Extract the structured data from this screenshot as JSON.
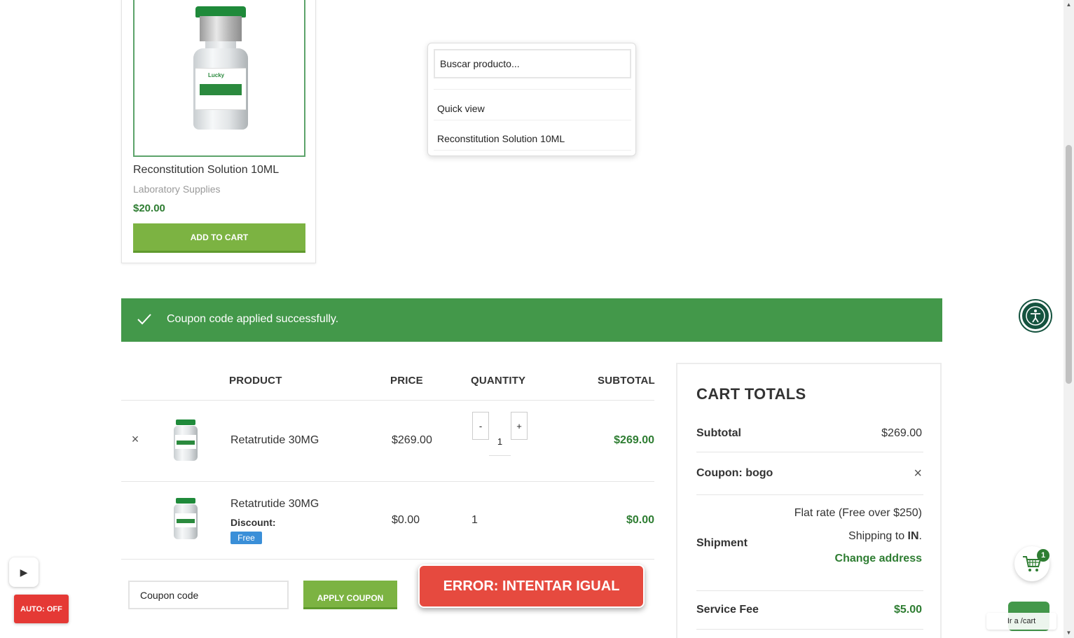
{
  "product_card": {
    "name": "Reconstitution Solution 10ML",
    "category": "Laboratory Supplies",
    "price": "$20.00",
    "add_to_cart_label": "ADD TO CART",
    "image_logo": "Lucky"
  },
  "popup": {
    "search_value": "Buscar producto...",
    "items": [
      "Quick view",
      "Reconstitution Solution 10ML"
    ]
  },
  "banner": {
    "message": "Coupon code applied successfully."
  },
  "cart_table": {
    "headers": {
      "product": "PRODUCT",
      "price": "PRICE",
      "quantity": "QUANTITY",
      "subtotal": "SUBTOTAL"
    },
    "rows": [
      {
        "name": "Retatrutide 30MG",
        "price": "$269.00",
        "quantity": "1",
        "subtotal": "$269.00"
      },
      {
        "name": "Retatrutide 30MG",
        "price": "$0.00",
        "quantity": "1",
        "subtotal": "$0.00",
        "discount_label": "Discount:",
        "badge": "Free"
      }
    ],
    "qty_minus": "-",
    "qty_plus": "+",
    "remove_glyph": "×"
  },
  "coupon": {
    "placeholder": "Coupon code",
    "apply_label": "APPLY COUPON"
  },
  "error_button": "ERROR: INTENTAR IGUAL",
  "cart_totals": {
    "title": "CART TOTALS",
    "subtotal_label": "Subtotal",
    "subtotal_value": "$269.00",
    "coupon_label": "Coupon: bogo",
    "coupon_remove": "×",
    "shipment_label": "Shipment",
    "shipping_method": "Flat rate (Free over $250)",
    "shipping_to_prefix": "Shipping to ",
    "shipping_to_country": "IN",
    "shipping_to_suffix": ".",
    "change_address": "Change address",
    "service_fee_label": "Service Fee",
    "service_fee_value": "$5.00"
  },
  "widgets": {
    "play_glyph": "▶",
    "auto_label": "AUTO: OFF",
    "cart_count": "1",
    "goto_label": "Ir a /cart"
  },
  "icons": {
    "accessibility": "accessibility-icon",
    "cart": "cart-icon",
    "check": "check-icon"
  },
  "colors": {
    "brand_green": "#43984a",
    "button_green": "#7cb342",
    "error_red": "#e64a3f",
    "price_green": "#2e7d32"
  }
}
